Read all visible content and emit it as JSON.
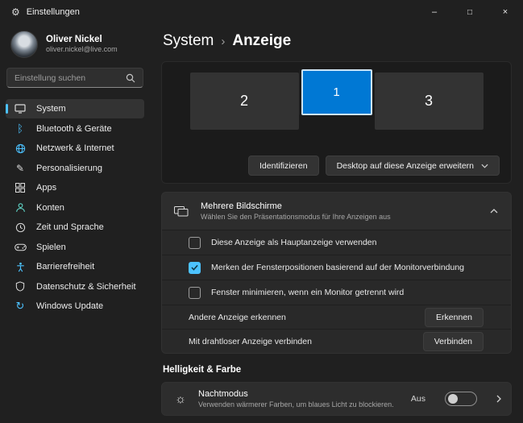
{
  "window": {
    "title": "Einstellungen"
  },
  "titlebar_controls": {
    "minimize": "–",
    "maximize": "□",
    "close": "×"
  },
  "sidebar": {
    "user": {
      "name": "Oliver Nickel",
      "email": "oliver.nickel@live.com"
    },
    "search": {
      "placeholder": "Einstellung suchen"
    },
    "items": [
      {
        "label": "System",
        "icon": "system-icon",
        "selected": true
      },
      {
        "label": "Bluetooth & Geräte",
        "icon": "bluetooth-icon",
        "selected": false
      },
      {
        "label": "Netzwerk & Internet",
        "icon": "network-icon",
        "selected": false
      },
      {
        "label": "Personalisierung",
        "icon": "personalization-icon",
        "selected": false
      },
      {
        "label": "Apps",
        "icon": "apps-icon",
        "selected": false
      },
      {
        "label": "Konten",
        "icon": "accounts-icon",
        "selected": false
      },
      {
        "label": "Zeit und Sprache",
        "icon": "time-language-icon",
        "selected": false
      },
      {
        "label": "Spielen",
        "icon": "gaming-icon",
        "selected": false
      },
      {
        "label": "Barrierefreiheit",
        "icon": "accessibility-icon",
        "selected": false
      },
      {
        "label": "Datenschutz & Sicherheit",
        "icon": "privacy-icon",
        "selected": false
      },
      {
        "label": "Windows Update",
        "icon": "update-icon",
        "selected": false
      }
    ]
  },
  "header": {
    "breadcrumb_parent": "System",
    "breadcrumb_current": "Anzeige"
  },
  "display_panel": {
    "monitors": [
      {
        "label": "2",
        "selected": false
      },
      {
        "label": "1",
        "selected": true
      },
      {
        "label": "3",
        "selected": false
      }
    ],
    "identify_button": "Identifizieren",
    "extend_dropdown": "Desktop auf diese Anzeige erweitern"
  },
  "multi_display": {
    "title": "Mehrere Bildschirme",
    "subtitle": "Wählen Sie den Präsentationsmodus für Ihre Anzeigen aus",
    "expanded": true,
    "checkboxes": [
      {
        "label": "Diese Anzeige als Hauptanzeige verwenden",
        "checked": false
      },
      {
        "label": "Merken der Fensterpositionen basierend auf der Monitorverbindung",
        "checked": true
      },
      {
        "label": "Fenster minimieren, wenn ein Monitor getrennt wird",
        "checked": false
      }
    ],
    "actions": [
      {
        "label": "Andere Anzeige erkennen",
        "button": "Erkennen"
      },
      {
        "label": "Mit drahtloser Anzeige verbinden",
        "button": "Verbinden"
      }
    ]
  },
  "brightness_section": {
    "title": "Helligkeit & Farbe",
    "night_mode": {
      "title": "Nachtmodus",
      "subtitle": "Verwenden wärmerer Farben, um blaues Licht zu blockieren.",
      "state": "Aus",
      "enabled": false
    }
  },
  "icons": {
    "gear": "⚙",
    "breadcrumb_separator": "›",
    "bluetooth": "ᛒ",
    "personalization": "✎",
    "update": "↻",
    "night_mode": "☼"
  },
  "colors": {
    "accent": "#0078d4",
    "accent_light": "#4cc2ff"
  }
}
